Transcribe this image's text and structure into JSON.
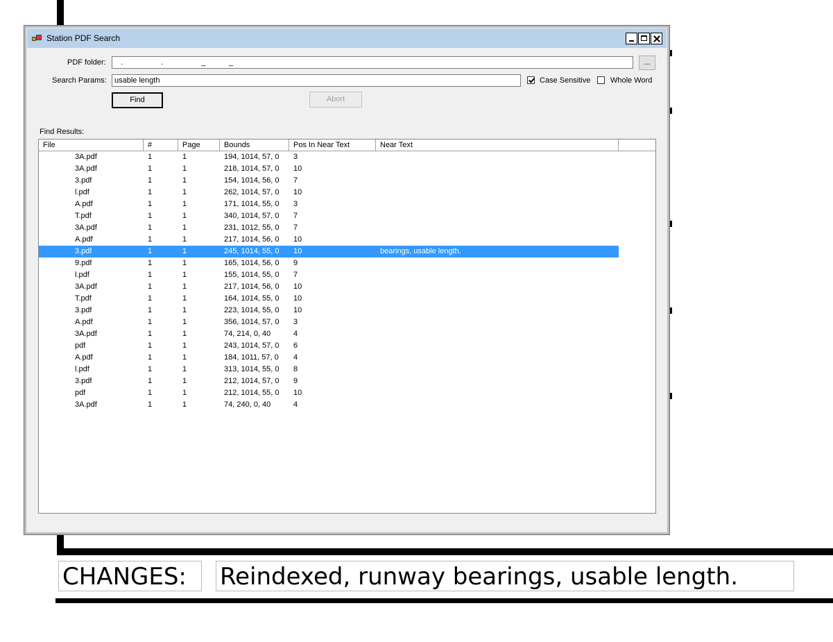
{
  "window": {
    "title": "Station PDF Search",
    "pdf_folder_label": "PDF folder:",
    "pdf_folder_value": "   .                  .                  _           _",
    "browse_label": "...",
    "search_params_label": "Search Params:",
    "search_params_value": "usable length",
    "case_sensitive_label": "Case Sensitive",
    "case_sensitive_checked": true,
    "whole_word_label": "Whole Word",
    "whole_word_checked": false,
    "find_label": "Find",
    "abort_label": "Abort",
    "results_label": "Find Results:"
  },
  "table": {
    "columns": [
      "File",
      "#",
      "Page",
      "Bounds",
      "Pos In Near Text",
      "Near Text"
    ],
    "rows": [
      {
        "file": "3A.pdf",
        "num": "1",
        "page": "1",
        "bounds": "194, 1014, 57, 0",
        "pos": "3",
        "near": "",
        "selected": false
      },
      {
        "file": "3A.pdf",
        "num": "1",
        "page": "1",
        "bounds": "218, 1014, 57, 0",
        "pos": "10",
        "near": "",
        "selected": false
      },
      {
        "file": "3.pdf",
        "num": "1",
        "page": "1",
        "bounds": "154, 1014, 56, 0",
        "pos": "7",
        "near": "",
        "selected": false
      },
      {
        "file": "l.pdf",
        "num": "1",
        "page": "1",
        "bounds": "262, 1014, 57, 0",
        "pos": "10",
        "near": "",
        "selected": false
      },
      {
        "file": "A.pdf",
        "num": "1",
        "page": "1",
        "bounds": "171, 1014, 55, 0",
        "pos": "3",
        "near": "",
        "selected": false
      },
      {
        "file": "T.pdf",
        "num": "1",
        "page": "1",
        "bounds": "340, 1014, 57, 0",
        "pos": "7",
        "near": "",
        "selected": false
      },
      {
        "file": "3A.pdf",
        "num": "1",
        "page": "1",
        "bounds": "231, 1012, 55, 0",
        "pos": "7",
        "near": "",
        "selected": false
      },
      {
        "file": "A.pdf",
        "num": "1",
        "page": "1",
        "bounds": "217, 1014, 56, 0",
        "pos": "10",
        "near": "",
        "selected": false
      },
      {
        "file": "3.pdf",
        "num": "1",
        "page": "1",
        "bounds": "245, 1014, 55, 0",
        "pos": "10",
        "near": "bearings, usable length.",
        "selected": true
      },
      {
        "file": "9.pdf",
        "num": "1",
        "page": "1",
        "bounds": "165, 1014, 56, 0",
        "pos": "9",
        "near": "",
        "selected": false
      },
      {
        "file": "l.pdf",
        "num": "1",
        "page": "1",
        "bounds": "155, 1014, 55, 0",
        "pos": "7",
        "near": "",
        "selected": false
      },
      {
        "file": "3A.pdf",
        "num": "1",
        "page": "1",
        "bounds": "217, 1014, 56, 0",
        "pos": "10",
        "near": "",
        "selected": false
      },
      {
        "file": "T.pdf",
        "num": "1",
        "page": "1",
        "bounds": "164, 1014, 55, 0",
        "pos": "10",
        "near": "",
        "selected": false
      },
      {
        "file": "3.pdf",
        "num": "1",
        "page": "1",
        "bounds": "223, 1014, 55, 0",
        "pos": "10",
        "near": "",
        "selected": false
      },
      {
        "file": "A.pdf",
        "num": "1",
        "page": "1",
        "bounds": "356, 1014, 57, 0",
        "pos": "3",
        "near": "",
        "selected": false
      },
      {
        "file": "3A.pdf",
        "num": "1",
        "page": "1",
        "bounds": "74, 214, 0, 40",
        "pos": "4",
        "near": "",
        "selected": false
      },
      {
        "file": "pdf",
        "num": "1",
        "page": "1",
        "bounds": "243, 1014, 57, 0",
        "pos": "6",
        "near": "",
        "selected": false
      },
      {
        "file": "A.pdf",
        "num": "1",
        "page": "1",
        "bounds": "184, 1011, 57, 0",
        "pos": "4",
        "near": "",
        "selected": false
      },
      {
        "file": "l.pdf",
        "num": "1",
        "page": "1",
        "bounds": "313, 1014, 55, 0",
        "pos": "8",
        "near": "",
        "selected": false
      },
      {
        "file": "3.pdf",
        "num": "1",
        "page": "1",
        "bounds": "212, 1014, 57, 0",
        "pos": "9",
        "near": "",
        "selected": false
      },
      {
        "file": "pdf",
        "num": "1",
        "page": "1",
        "bounds": "212, 1014, 55, 0",
        "pos": "10",
        "near": "",
        "selected": false
      },
      {
        "file": "3A.pdf",
        "num": "1",
        "page": "1",
        "bounds": "74, 240, 0, 40",
        "pos": "4",
        "near": "",
        "selected": false
      }
    ]
  },
  "caption": {
    "changes_label": "CHANGES:",
    "changes_text": "Reindexed, runway bearings, usable length."
  },
  "colors": {
    "selection": "#3399ff",
    "titlebar": "#b9d1ea"
  }
}
